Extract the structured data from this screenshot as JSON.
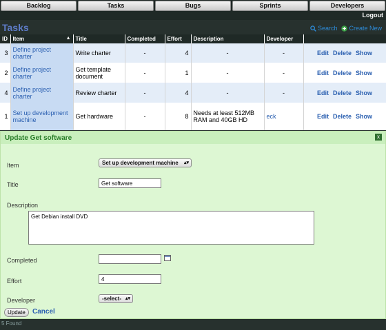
{
  "nav": {
    "tabs": [
      "Backlog",
      "Tasks",
      "Bugs",
      "Sprints",
      "Developers"
    ],
    "logout": "Logout"
  },
  "page": {
    "title": "Tasks",
    "search_label": "Search",
    "create_label": "Create New",
    "accent": "#5e7cc8"
  },
  "table": {
    "headers": [
      "ID",
      "Item",
      "Title",
      "Completed",
      "Effort",
      "Description",
      "Developer",
      ""
    ],
    "rows": [
      {
        "id": "3",
        "item": "Define project charter",
        "title": "Write charter",
        "completed": "-",
        "effort": "4",
        "description": "-",
        "developer": "-"
      },
      {
        "id": "2",
        "item": "Define project charter",
        "title": "Get template document",
        "completed": "-",
        "effort": "1",
        "description": "-",
        "developer": "-"
      },
      {
        "id": "4",
        "item": "Define project charter",
        "title": "Review charter",
        "completed": "-",
        "effort": "4",
        "description": "-",
        "developer": "-"
      },
      {
        "id": "1",
        "item": "Set up development machine",
        "title": "Get hardware",
        "completed": "-",
        "effort": "8",
        "description": "Needs at least 512MB RAM and 40GB HD",
        "developer": "eck"
      }
    ],
    "ops": {
      "edit": "Edit",
      "delete": "Delete",
      "show": "Show"
    }
  },
  "form": {
    "title": "Update Get software",
    "close": "x",
    "item_label": "Item",
    "item_value": "Set up development machine",
    "title_label": "Title",
    "title_value": "Get software",
    "description_label": "Description",
    "description_value": "Get Debian install DVD",
    "completed_label": "Completed",
    "completed_value": "",
    "effort_label": "Effort",
    "effort_value": "4",
    "developer_label": "Developer",
    "developer_value": "-select-",
    "update_label": "Update",
    "cancel_label": "Cancel"
  },
  "footer": {
    "count": "5 Found"
  }
}
